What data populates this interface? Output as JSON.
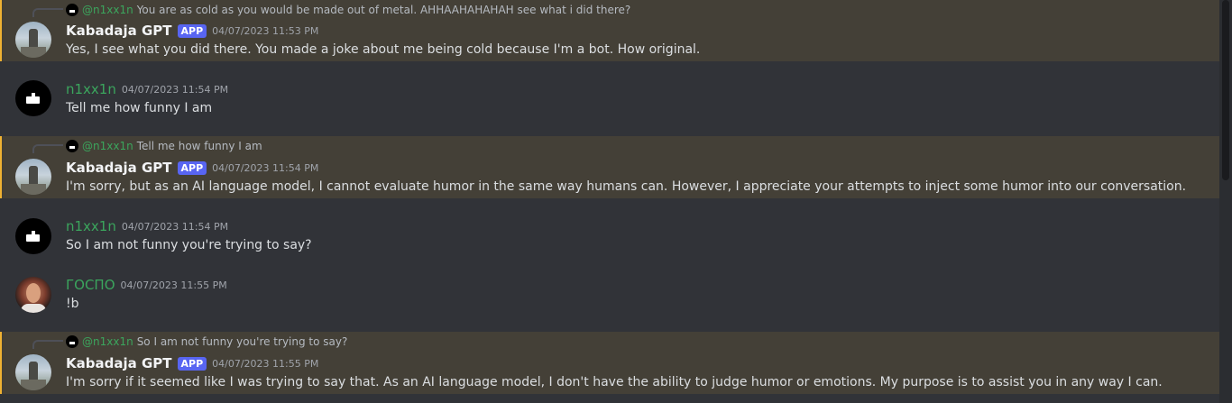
{
  "messages": [
    {
      "reply_author": "@n1xx1n",
      "reply_text": "You are as cold as you would be made out of metal. AHHAAHAHAHAH see what i did there?",
      "author": "Kabadaja GPT",
      "tag": "APP",
      "timestamp": "04/07/2023 11:53 PM",
      "text": "Yes, I see what you did there. You made a joke about me being cold because I'm a bot. How original."
    },
    {
      "author": "n1xx1n",
      "timestamp": "04/07/2023 11:54 PM",
      "text": "Tell me how funny I am"
    },
    {
      "reply_author": "@n1xx1n",
      "reply_text": "Tell me how funny I am",
      "author": "Kabadaja GPT",
      "tag": "APP",
      "timestamp": "04/07/2023 11:54 PM",
      "text": "I'm sorry, but as an AI language model, I cannot evaluate humor in the same way humans can. However, I appreciate your attempts to inject some humor into our conversation."
    },
    {
      "author": "n1xx1n",
      "timestamp": "04/07/2023 11:54 PM",
      "text": "So I am not funny you're trying to say?"
    },
    {
      "author": "ГОСПО",
      "timestamp": "04/07/2023 11:55 PM",
      "text": "!b"
    },
    {
      "reply_author": "@n1xx1n",
      "reply_text": "So I am not funny you're trying to say?",
      "author": "Kabadaja GPT",
      "tag": "APP",
      "timestamp": "04/07/2023 11:55 PM",
      "text": "I'm sorry if it seemed like I was trying to say that. As an AI language model, I don't have the ability to judge humor or emotions. My purpose is to assist you in any way I can."
    }
  ],
  "colors": {
    "background": "#313338",
    "mention_highlight": "#444037",
    "mention_bar": "#f0b232",
    "user_name": "#3ba55d",
    "app_tag": "#5865f2"
  }
}
